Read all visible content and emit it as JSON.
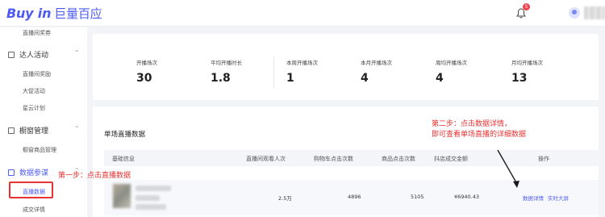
{
  "header": {
    "logo_en": "Buy in",
    "logo_cn": "巨量百应",
    "notification_count": "5",
    "accent": "#4d5bf2"
  },
  "sidebar": {
    "item_top": "直播间奖券",
    "group_talent": "达人活动",
    "talent_items": [
      "直播间奖励",
      "大促活动",
      "星云计划"
    ],
    "group_window": "橱窗管理",
    "window_items": [
      "橱窗商品管理"
    ],
    "group_data": "数据参谋",
    "data_items": [
      "直播数据",
      "成交详情"
    ]
  },
  "stats": [
    {
      "label": "开播场次",
      "value": "30"
    },
    {
      "label": "平均开播时长",
      "value": "1.8"
    },
    {
      "label": "本周开播场次",
      "value": "1"
    },
    {
      "label": "本月开播场次",
      "value": "4"
    },
    {
      "label": "周均开播场次",
      "value": "4"
    },
    {
      "label": "月均开播场次",
      "value": "13"
    }
  ],
  "live_section": {
    "title": "单场直播数据",
    "columns": [
      "基础信息",
      "直播间观看人次",
      "购物车点击次数",
      "商品点击次数",
      "抖店成交金额",
      "操作"
    ],
    "row": {
      "viewers": "2.5万",
      "cart_clicks": "4896",
      "product_clicks": "5105",
      "gmv": "¥6940.43",
      "action_detail": "数据详情",
      "action_screen": "实时大屏"
    }
  },
  "annotations": {
    "step1": "第一步：点击直播数据",
    "step2_line1": "第二步：点击数据详情，",
    "step2_line2": "即可查看单场直播的详细数据",
    "color": "#e63232"
  }
}
